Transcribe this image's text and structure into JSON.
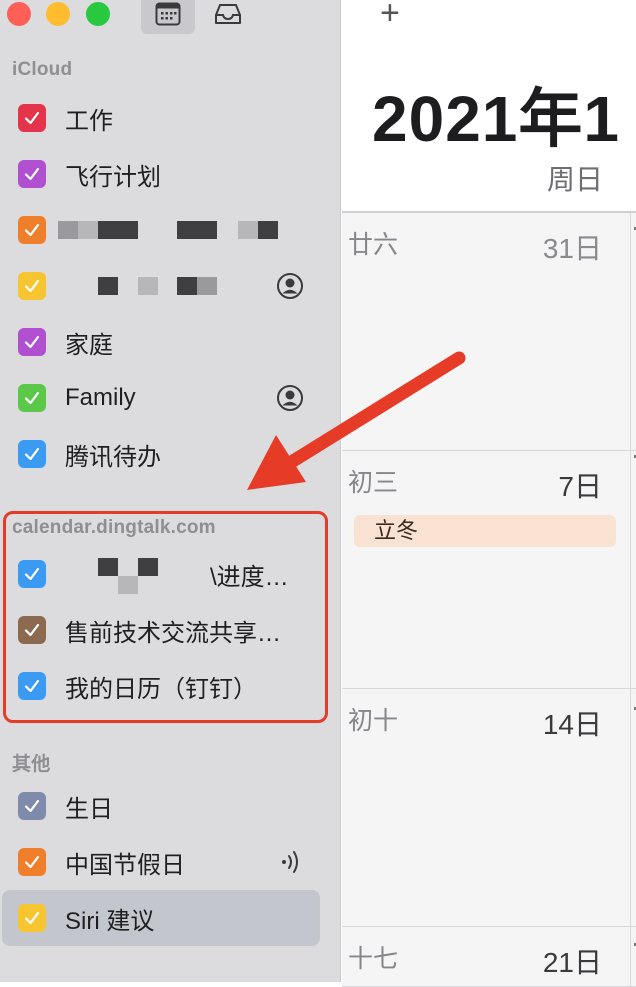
{
  "sidebar": {
    "sections": {
      "icloud": "iCloud",
      "dingtalk": "calendar.dingtalk.com",
      "other": "其他"
    },
    "icloud_items": [
      {
        "label": "工作",
        "color": "#e3344c"
      },
      {
        "label": "飞行计划",
        "color": "#b04fd0"
      },
      {
        "label": "",
        "color": "#f07f2c"
      },
      {
        "label": "",
        "color": "#f6c530"
      },
      {
        "label": "家庭",
        "color": "#b04fd0"
      },
      {
        "label": "Family",
        "color": "#5cc84a"
      },
      {
        "label": "腾讯待办",
        "color": "#3b9bf2"
      }
    ],
    "dingtalk_items": [
      {
        "label": "\\进度…",
        "color": "#3b9bf2"
      },
      {
        "label": "售前技术交流共享…",
        "color": "#8c6a4f"
      },
      {
        "label": "我的日历（钉钉）",
        "color": "#3b9bf2"
      }
    ],
    "other_items": [
      {
        "label": "生日",
        "color": "#7f8bad"
      },
      {
        "label": "中国节假日",
        "color": "#f07f2c"
      },
      {
        "label": "Siri 建议",
        "color": "#f6c530"
      }
    ]
  },
  "main": {
    "add_label": "+",
    "month_title": "2021年1",
    "weekday": "周日",
    "weeks": [
      {
        "lunar": "廿六",
        "day": "31日"
      },
      {
        "lunar": "初三",
        "day": "7日",
        "event": "立冬"
      },
      {
        "lunar": "初十",
        "day": "14日"
      },
      {
        "lunar": "十七",
        "day": "21日"
      }
    ]
  },
  "colors": {
    "highlight": "#e63b27",
    "sidebar_bg": "#dcdcdf"
  }
}
